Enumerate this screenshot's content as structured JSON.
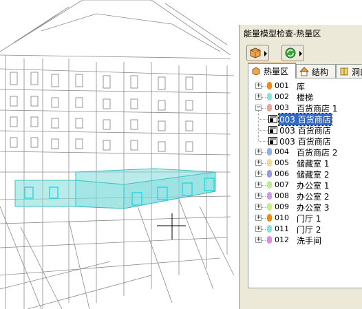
{
  "window": {
    "title": "能量模型检查-热量区"
  },
  "toolbar": {
    "buttons": [
      {
        "icon": "model-cube-icon"
      },
      {
        "icon": "refresh-green-icon"
      }
    ]
  },
  "tabs": [
    {
      "label": "热量区",
      "icon": "zone-icon",
      "active": true
    },
    {
      "label": "结构",
      "icon": "house-icon",
      "active": false
    },
    {
      "label": "洞口",
      "icon": "opening-icon",
      "active": false
    }
  ],
  "tree": {
    "items": [
      {
        "num": "001",
        "name": "库",
        "color": "#ee8a1a",
        "expanded": false,
        "children": []
      },
      {
        "num": "002",
        "name": "楼梯",
        "color": "#8ee0d9",
        "expanded": false,
        "children": []
      },
      {
        "num": "003",
        "name": "百货商店 1",
        "color": "#e8a696",
        "expanded": true,
        "children": [
          {
            "label": "003 百货商店",
            "selected": true
          },
          {
            "label": "003 百货商店",
            "selected": false
          },
          {
            "label": "003 百货商店",
            "selected": false
          }
        ]
      },
      {
        "num": "004",
        "name": "百货商店 2",
        "color": "#8fb0e8",
        "expanded": false,
        "children": []
      },
      {
        "num": "005",
        "name": "储藏室 1",
        "color": "#eedc96",
        "expanded": false,
        "children": []
      },
      {
        "num": "006",
        "name": "储藏室 2",
        "color": "#9a9ae0",
        "expanded": false,
        "children": []
      },
      {
        "num": "007",
        "name": "办公室 1",
        "color": "#b8ee96",
        "expanded": false,
        "children": []
      },
      {
        "num": "008",
        "name": "办公室 2",
        "color": "#d49ae8",
        "expanded": false,
        "children": []
      },
      {
        "num": "009",
        "name": "办公室 3",
        "color": "#c8ee8a",
        "expanded": false,
        "children": []
      },
      {
        "num": "010",
        "name": "门厅 1",
        "color": "#ee8a1a",
        "expanded": false,
        "children": []
      },
      {
        "num": "011",
        "name": "门厅 2",
        "color": "#8ee0d9",
        "expanded": false,
        "children": []
      },
      {
        "num": "012",
        "name": "洗手间",
        "color": "#e08ae8",
        "expanded": false,
        "children": []
      }
    ]
  },
  "colors": {
    "highlight_zone": "#7fdada",
    "selection": "#316ac5",
    "panel_bg": "#ece9d8"
  }
}
